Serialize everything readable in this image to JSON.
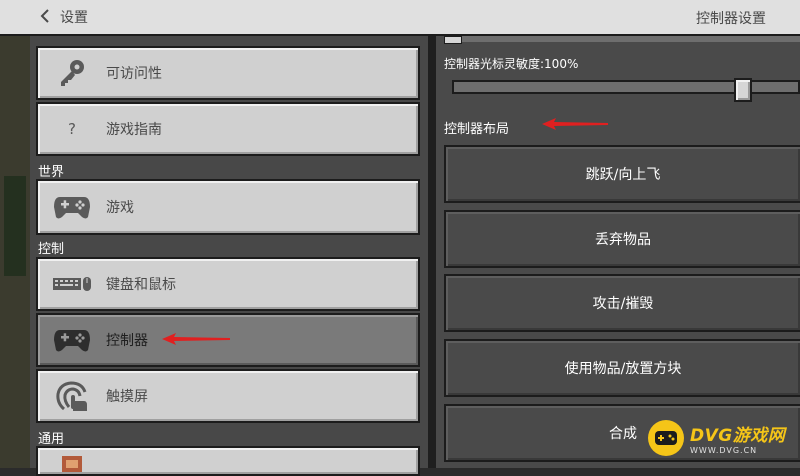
{
  "header": {
    "back_label": "设置",
    "title": "控制器设置"
  },
  "menu": {
    "items": [
      {
        "label": "可访问性",
        "icon": "key-icon"
      },
      {
        "label": "游戏指南",
        "icon": "question-icon",
        "glyph": "?"
      },
      {
        "label": "游戏",
        "icon": "controller-icon"
      },
      {
        "label": "键盘和鼠标",
        "icon": "keyboard-mouse-icon"
      },
      {
        "label": "控制器",
        "icon": "controller-icon",
        "selected": true
      },
      {
        "label": "触摸屏",
        "icon": "touch-icon"
      },
      {
        "label": "",
        "icon": "general-item-icon"
      }
    ],
    "sections": {
      "world": "世界",
      "controls": "控制",
      "general": "通用"
    }
  },
  "settings": {
    "sensitivity_label": "控制器光标灵敏度:100%",
    "sensitivity_value": 1.0,
    "layout_label": "控制器布局",
    "bindings": [
      "跳跃/向上飞",
      "丢弃物品",
      "攻击/摧毁",
      "使用物品/放置方块",
      "合成"
    ]
  },
  "watermark": {
    "title": "DVG游戏网",
    "subtitle": "WWW.DVG.CN"
  },
  "colors": {
    "header_bg": "#e0e0e0",
    "button_bg": "#d0d0d0",
    "selected_bg": "#7a7a7a",
    "panel_bg": "#4a4a4a",
    "arrow_red": "#e02020",
    "watermark_yellow": "#f5c518"
  }
}
